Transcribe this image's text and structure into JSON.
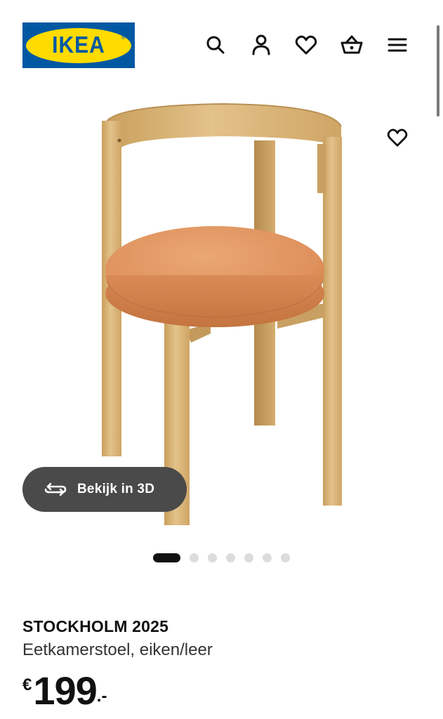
{
  "header": {
    "logo_text": "IKEA",
    "logo_colors": {
      "background": "#0058a3",
      "oval": "#ffdb00"
    },
    "icons": [
      "search-icon",
      "account-icon",
      "wishlist-heart-icon",
      "cart-basket-icon",
      "menu-hamburger-icon"
    ]
  },
  "gallery": {
    "favorite_icon": "heart-outline-icon",
    "view_3d_label": "Bekijk in 3D",
    "view_3d_icon": "rotate-3d-icon",
    "dots_total": 7,
    "active_dot": 1
  },
  "product": {
    "name": "STOCKHOLM 2025",
    "description": "Eetkamerstoel, eiken/leer",
    "price": {
      "currency": "€",
      "amount": "199",
      "suffix": ".-"
    }
  },
  "colors": {
    "wood": "#dcb777",
    "leather": "#e0955f",
    "button_dark": "#4a4a4a",
    "text": "#111111"
  }
}
